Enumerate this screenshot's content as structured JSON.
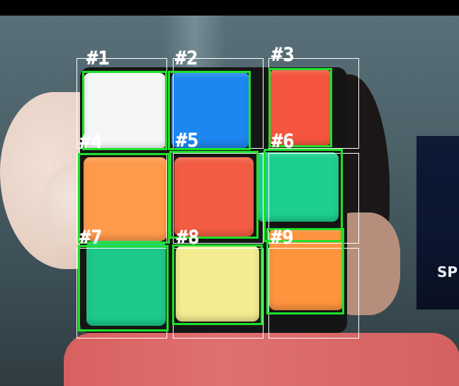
{
  "scene": {
    "background_text": "SP"
  },
  "cells": [
    {
      "label": "#1",
      "color": "#f4f6f7"
    },
    {
      "label": "#2",
      "color": "#1e86f0"
    },
    {
      "label": "#3",
      "color": "#f5553f"
    },
    {
      "label": "#4",
      "color": "#ff9a4a"
    },
    {
      "label": "#5",
      "color": "#f25c43"
    },
    {
      "label": "#6",
      "color": "#1dcf8e"
    },
    {
      "label": "#7",
      "color": "#1cc98a"
    },
    {
      "label": "#8",
      "color": "#f3ec90"
    },
    {
      "label": "#9",
      "color": "#ff943f"
    }
  ],
  "colors": {
    "grid_box": "#ffffff",
    "detection_box": "#1ee02a",
    "label_text": "#ffffff"
  }
}
